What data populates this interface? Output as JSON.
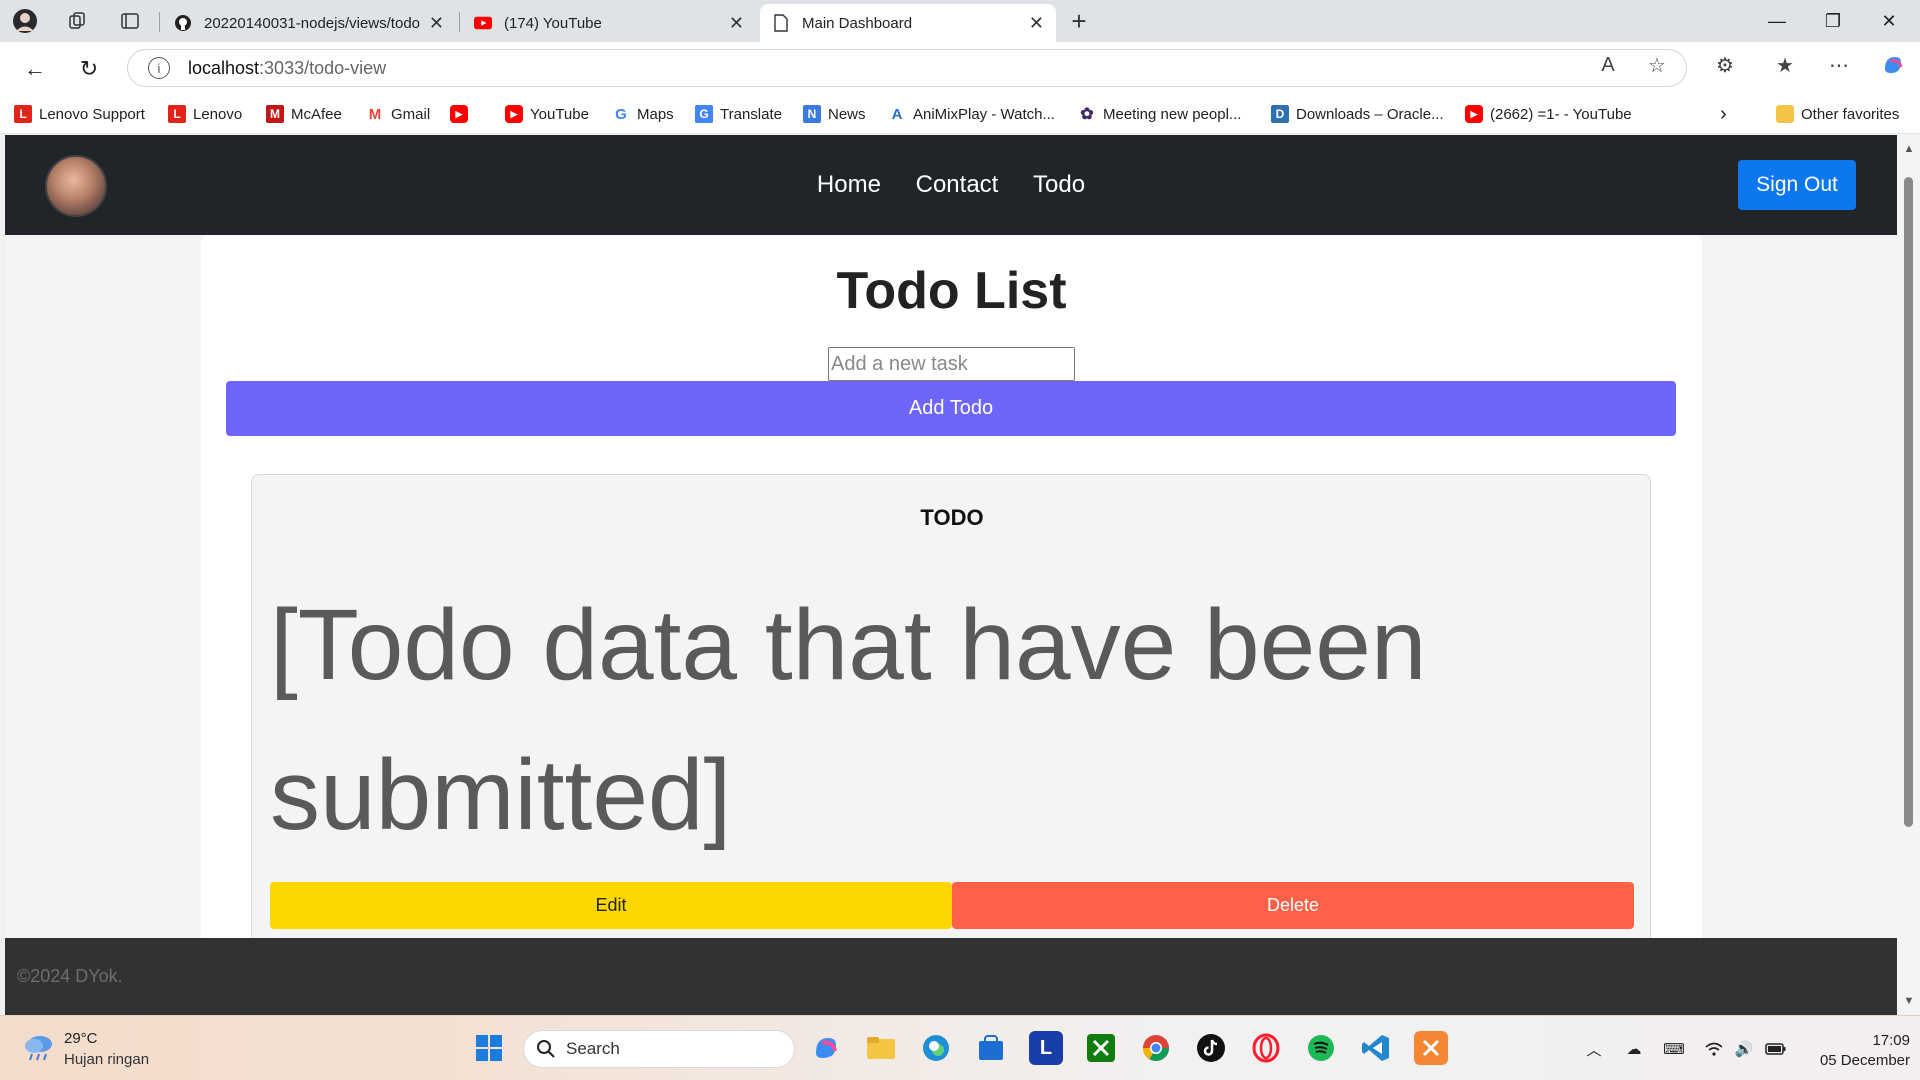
{
  "browser": {
    "tabs": [
      {
        "label": "20220140031-nodejs/views/todo...",
        "icon": "github-icon"
      },
      {
        "label": "(174) YouTube",
        "icon": "youtube-icon"
      },
      {
        "label": "Main Dashboard",
        "icon": "page-icon",
        "active": true
      }
    ],
    "address": {
      "host": "localhost",
      "path": ":3033/todo-view"
    },
    "bookmarks": [
      {
        "label": "Lenovo Support",
        "icon": "L",
        "color": "#e2231a"
      },
      {
        "label": "Lenovo",
        "icon": "L",
        "color": "#e2231a"
      },
      {
        "label": "McAfee",
        "icon": "M",
        "color": "#c01818"
      },
      {
        "label": "Gmail",
        "icon": "M",
        "color": "#ea4335"
      },
      {
        "label": "",
        "icon": "▶",
        "color": "#ff0000"
      },
      {
        "label": "YouTube",
        "icon": "▶",
        "color": "#ff0000"
      },
      {
        "label": "Maps",
        "icon": "G",
        "color": "#4285f4"
      },
      {
        "label": "Translate",
        "icon": "G",
        "color": "#4285f4"
      },
      {
        "label": "News",
        "icon": "N",
        "color": "#3b7be0"
      },
      {
        "label": "AniMixPlay - Watch...",
        "icon": "A",
        "color": "#2a6fd6"
      },
      {
        "label": "Meeting new peopl...",
        "icon": "✿",
        "color": "#3d2a6a"
      },
      {
        "label": "Downloads – Oracle...",
        "icon": "D",
        "color": "#2f6fb3"
      },
      {
        "label": "(2662) =1- - YouTube",
        "icon": "▶",
        "color": "#ff0000"
      }
    ],
    "other_favorites": "Other favorites"
  },
  "app": {
    "nav": {
      "links": [
        "Home",
        "Contact",
        "Todo"
      ],
      "signout": "Sign Out"
    },
    "title": "Todo List",
    "input_placeholder": "Add a new task",
    "add_button": "Add Todo",
    "todo_card": {
      "heading": "TODO",
      "text": "[Todo data that have been submitted]",
      "edit": "Edit",
      "delete": "Delete"
    },
    "footer": "©2024 DYok.",
    "colors": {
      "navbar": "#212529",
      "signout": "#0d78ee",
      "add": "#6e65fb",
      "edit": "#fdd800",
      "delete": "#ff6148",
      "footer": "#323232"
    }
  },
  "taskbar": {
    "weather": {
      "temp": "29°C",
      "summary": "Hujan ringan"
    },
    "search_label": "Search",
    "clock": {
      "time": "17:09",
      "date": "05 December"
    }
  }
}
